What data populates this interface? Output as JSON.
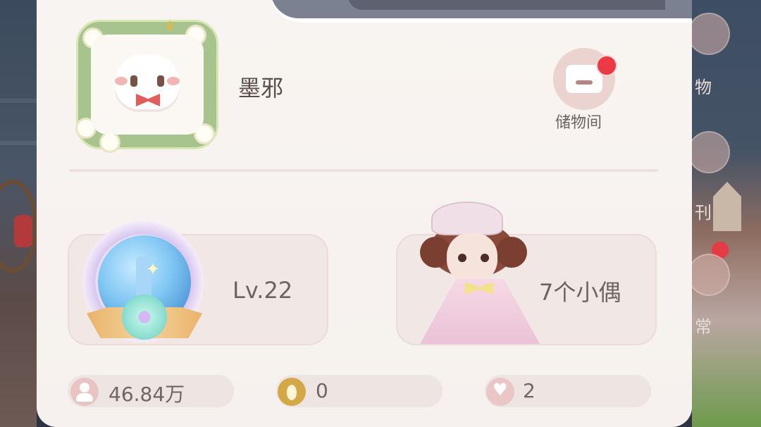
{
  "profile": {
    "username": "墨邪"
  },
  "storage": {
    "label": "储物间",
    "has_notification": true
  },
  "cards": {
    "level": "Lv.22",
    "dolls": "7个小偶"
  },
  "stats": {
    "fans": "46.84万",
    "footprints": "0",
    "likes": "2"
  },
  "background_nav": {
    "items": [
      "物",
      "刊",
      "常"
    ]
  },
  "colors": {
    "panel_bg": "#f6f1ee",
    "card_bg": "#f1e7e4",
    "notification_red": "#ea3a44",
    "text": "#6e6363"
  }
}
